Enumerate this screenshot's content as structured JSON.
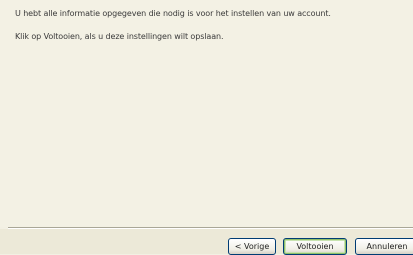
{
  "message": {
    "line1": "U hebt alle informatie opgegeven die nodig is voor het instellen van uw account.",
    "line2": "Klik op Voltooien, als u deze instellingen wilt opslaan."
  },
  "buttons": {
    "back_label": "< Vorige",
    "finish_label": "Voltooien",
    "cancel_label": "Annuleren"
  }
}
